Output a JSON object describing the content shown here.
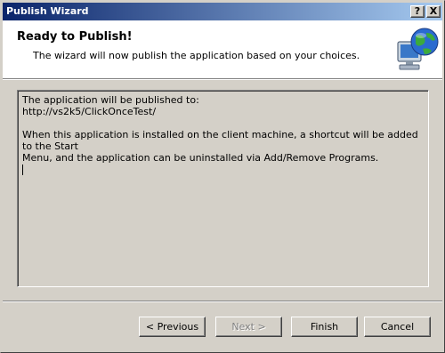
{
  "window": {
    "title": "Publish Wizard",
    "help_glyph": "?",
    "close_glyph": "X"
  },
  "header": {
    "title": "Ready to Publish!",
    "subtitle": "The wizard will now publish the application based on your choices.",
    "icon": "publish-globe-computer-icon"
  },
  "summary": {
    "line1": "The application will be published to:",
    "line2": "http://vs2k5/ClickOnceTest/",
    "line3": "When this application is installed on the client machine, a shortcut will be added to the Start",
    "line4": "Menu, and the application can be uninstalled via Add/Remove Programs."
  },
  "buttons": {
    "previous": "< Previous",
    "next": "Next >",
    "finish": "Finish",
    "cancel": "Cancel",
    "next_enabled": false
  },
  "colors": {
    "titlebar_start": "#0a246a",
    "titlebar_end": "#a6caf0",
    "face": "#d4d0c8"
  }
}
